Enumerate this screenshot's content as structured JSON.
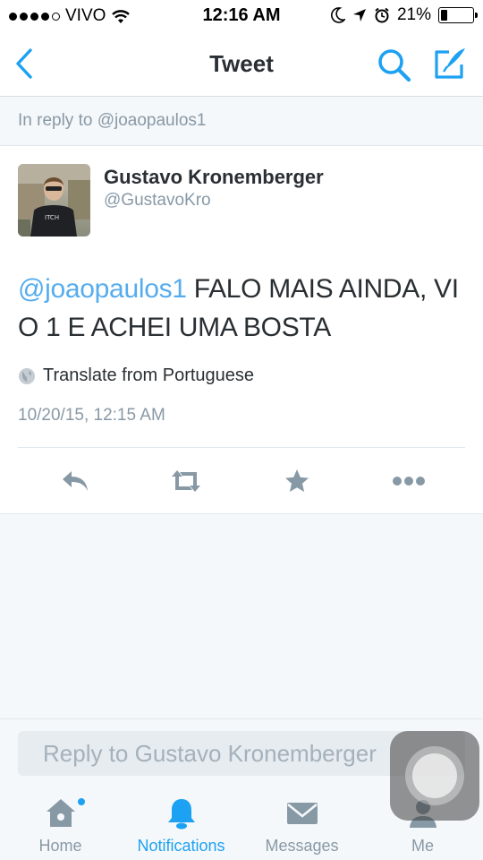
{
  "status_bar": {
    "carrier": "VIVO",
    "time": "12:16 AM",
    "battery": "21%",
    "battery_level": 0.21
  },
  "nav": {
    "title": "Tweet",
    "back_icon": "chevron-left-icon",
    "search_icon": "search-icon",
    "compose_icon": "compose-icon",
    "accent_color": "#1da1f2"
  },
  "reply_context": "In reply to @joaopaulos1",
  "tweet": {
    "author_name": "Gustavo Kronemberger",
    "author_handle": "@GustavoKro",
    "mention": "@joaopaulos1",
    "text": " FALO MAIS AINDA, VI O 1 E ACHEI UMA BOSTA",
    "translate_label": "Translate from Portuguese",
    "timestamp": "10/20/15, 12:15 AM",
    "actions": [
      "reply-icon",
      "retweet-icon",
      "like-icon",
      "more-icon"
    ]
  },
  "reply_bar": {
    "placeholder": "Reply to Gustavo Kronemberger"
  },
  "tab_bar": {
    "tabs": [
      {
        "label": "Home",
        "icon": "home-icon",
        "has_badge": true
      },
      {
        "label": "Notifications",
        "icon": "bell-icon",
        "active": true
      },
      {
        "label": "Messages",
        "icon": "envelope-icon"
      },
      {
        "label": "Me",
        "icon": "person-icon"
      }
    ]
  }
}
